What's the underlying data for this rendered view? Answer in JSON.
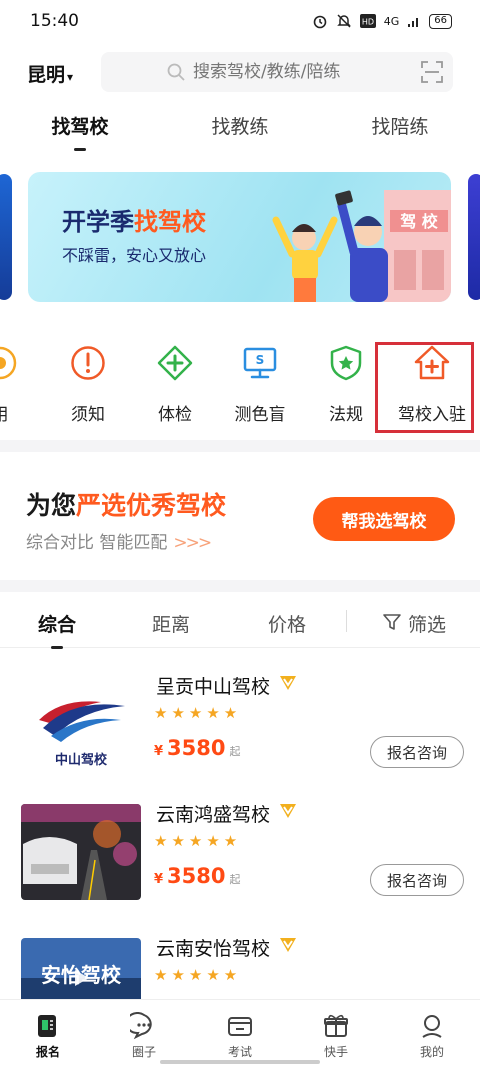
{
  "status_bar": {
    "time": "15:40",
    "network": "4G",
    "battery": "66"
  },
  "header": {
    "city": "昆明",
    "search_placeholder": "搜索驾校/教练/陪练"
  },
  "top_tabs": [
    {
      "label": "找驾校",
      "active": true
    },
    {
      "label": "找教练",
      "active": false
    },
    {
      "label": "找陪练",
      "active": false
    }
  ],
  "banner": {
    "title_prefix": "开学季",
    "title_highlight": "找驾校",
    "subtitle": "不踩雷，安心又放心",
    "sign_text": "驾 校"
  },
  "quick_links": [
    {
      "label": "用",
      "icon": "partial-icon"
    },
    {
      "label": "须知",
      "icon": "exclamation-circle-icon"
    },
    {
      "label": "体检",
      "icon": "plus-diamond-icon"
    },
    {
      "label": "测色盲",
      "icon": "monitor-icon"
    },
    {
      "label": "法规",
      "icon": "shield-star-icon"
    },
    {
      "label": "驾校入驻",
      "icon": "house-plus-icon"
    }
  ],
  "promo": {
    "title_prefix": "为您",
    "title_highlight": "严选优秀驾校",
    "subtitle": "综合对比 智能匹配",
    "arrows": ">>>",
    "button": "帮我选驾校"
  },
  "filters": {
    "items": [
      {
        "label": "综合",
        "active": true
      },
      {
        "label": "距离",
        "active": false
      },
      {
        "label": "价格",
        "active": false
      }
    ],
    "filter_label": "筛选"
  },
  "schools": [
    {
      "name": "呈贡中山驾校",
      "stars": "★★★★★",
      "currency": "¥",
      "price": "3580",
      "suffix": "起",
      "consult": "报名咨询",
      "thumb_text": "中山驾校"
    },
    {
      "name": "云南鸿盛驾校",
      "stars": "★★★★★",
      "currency": "¥",
      "price": "3580",
      "suffix": "起",
      "consult": "报名咨询"
    },
    {
      "name": "云南安怡驾校",
      "stars": "★★★★★",
      "thumb_text": "安怡驾校"
    }
  ],
  "bottom_nav": [
    {
      "label": "报名",
      "active": true
    },
    {
      "label": "圈子",
      "active": false
    },
    {
      "label": "考试",
      "active": false
    },
    {
      "label": "快手",
      "active": false
    },
    {
      "label": "我的",
      "active": false
    }
  ],
  "colors": {
    "accent": "#ff5a14",
    "highlight_box": "#d6303a",
    "star": "#f5a623"
  }
}
